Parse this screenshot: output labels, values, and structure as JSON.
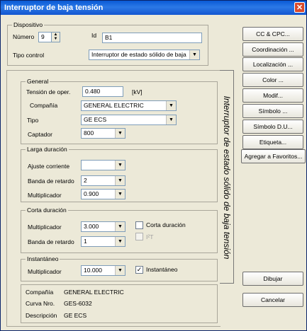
{
  "window": {
    "title": "Interruptor de baja tensión"
  },
  "device": {
    "legend": "Dispositivo",
    "numero_label": "Número",
    "numero_value": "9",
    "id_label": "Id",
    "id_value": "B1",
    "tipo_control_label": "Tipo control",
    "tipo_control_value": "Interruptor de estado sólido de baja"
  },
  "tab": {
    "label": "Interruptor de estado sólido de baja tensión"
  },
  "general": {
    "legend": "General",
    "tension_label": "Tensión de oper.",
    "tension_value": "0.480",
    "tension_unit": "[kV]",
    "compania_label": "Compañía",
    "compania_value": "GENERAL ELECTRIC",
    "tipo_label": "Tipo",
    "tipo_value": "GE ECS",
    "captador_label": "Captador",
    "captador_value": "800"
  },
  "larga": {
    "legend": "Larga duración",
    "ajuste_label": "Ajuste corriente",
    "ajuste_value": "",
    "banda_label": "Banda de retardo",
    "banda_value": "2",
    "mult_label": "Multiplicador",
    "mult_value": "0.900"
  },
  "corta": {
    "legend": "Corta duración",
    "mult_label": "Multiplicador",
    "mult_value": "3.000",
    "banda_label": "Banda de retardo",
    "banda_value": "1",
    "chk_corta_label": "Corta duración",
    "chk_i2t_label": "I²T"
  },
  "inst": {
    "legend": "Instantáneo",
    "mult_label": "Multiplicador",
    "mult_value": "10.000",
    "chk_label": "Instantáneo",
    "chk_mark": "✓"
  },
  "info": {
    "compania_label": "Compañía",
    "compania_value": "GENERAL ELECTRIC",
    "curva_label": "Curva Nro.",
    "curva_value": "GES-6032",
    "desc_label": "Descripción",
    "desc_value": "GE ECS"
  },
  "buttons": {
    "cc_cpc": "CC & CPC...",
    "coordinacion": "Coordinación ...",
    "localizacion": "Localización ...",
    "color": "Color ...",
    "modif": "Modif...",
    "simbolo": "Símbolo ...",
    "simbolo_du": "Símbolo D.U...",
    "etiqueta": "Etiqueta...",
    "favoritos": "Agregar a Favoritos...",
    "dibujar": "Dibujar",
    "cancelar": "Cancelar"
  },
  "icons": {
    "close": "close-icon",
    "dropdown": "chevron-down-icon",
    "spinner": "spinner-icon"
  },
  "colors": {
    "titlebar": "#0a5ad6",
    "window_bg": "#ece9d8",
    "close": "#d9492b"
  }
}
